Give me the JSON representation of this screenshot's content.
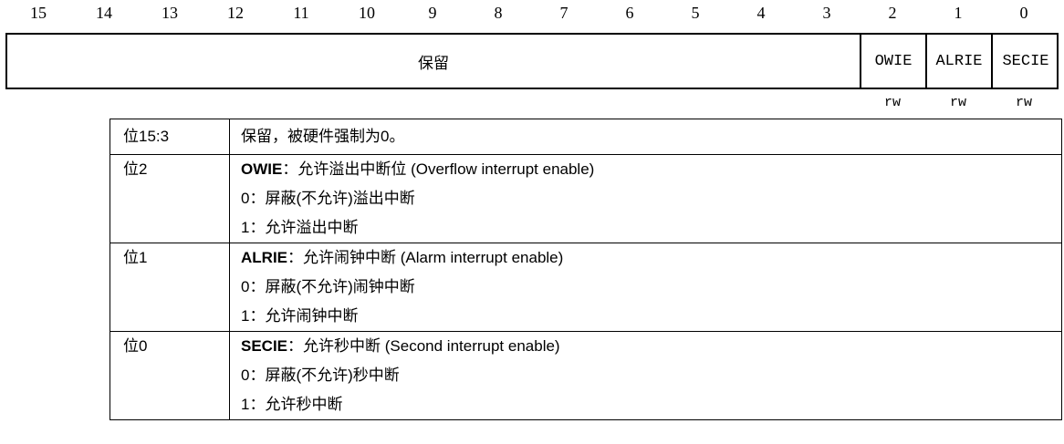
{
  "bit_numbers": [
    "15",
    "14",
    "13",
    "12",
    "11",
    "10",
    "9",
    "8",
    "7",
    "6",
    "5",
    "4",
    "3",
    "2",
    "1",
    "0"
  ],
  "register": {
    "reserved_label": "保留",
    "fields": [
      {
        "name": "OWIE",
        "access": "rw"
      },
      {
        "name": "ALRIE",
        "access": "rw"
      },
      {
        "name": "SECIE",
        "access": "rw"
      }
    ]
  },
  "descriptions": [
    {
      "bit": "位15:3",
      "lines": [
        "保留，被硬件强制为0。"
      ]
    },
    {
      "bit": "位2",
      "name": "OWIE",
      "title": "：允许溢出中断位 (Overflow interrupt enable)",
      "lines": [
        "0：屏蔽(不允许)溢出中断",
        "1：允许溢出中断"
      ]
    },
    {
      "bit": "位1",
      "name": "ALRIE",
      "title": "：允许闹钟中断 (Alarm interrupt enable)",
      "lines": [
        "0：屏蔽(不允许)闹钟中断",
        "1：允许闹钟中断"
      ]
    },
    {
      "bit": "位0",
      "name": "SECIE",
      "title": "：允许秒中断 (Second interrupt enable)",
      "lines": [
        "0：屏蔽(不允许)秒中断",
        "1：允许秒中断"
      ]
    }
  ]
}
